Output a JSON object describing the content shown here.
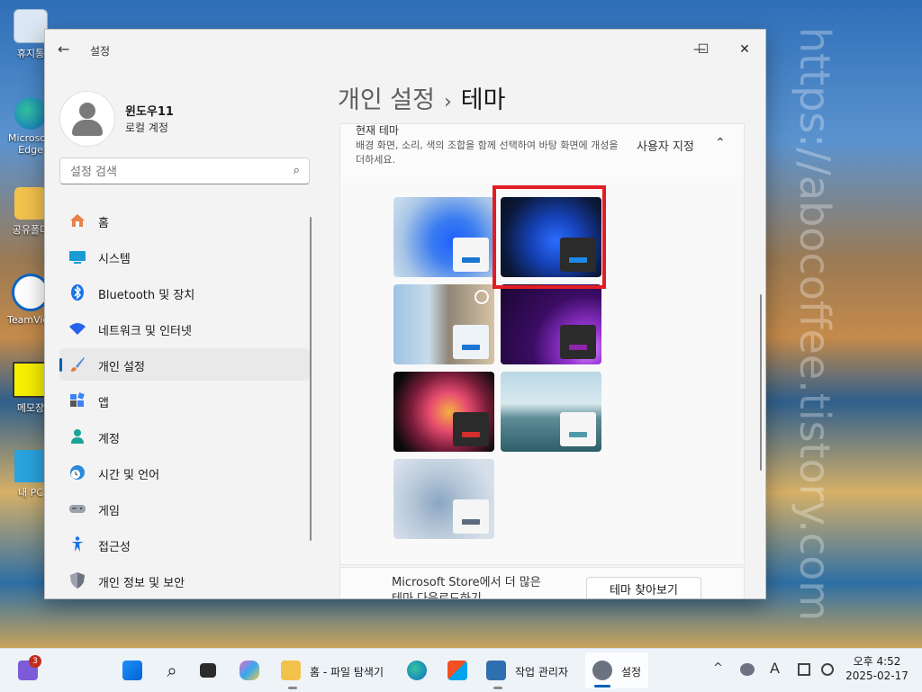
{
  "desktop": {
    "icons": [
      {
        "label": "휴지통",
        "icon": "recycle-bin-icon"
      },
      {
        "label": "Microsoft Edge",
        "icon": "edge-icon"
      },
      {
        "label": "공유폴더",
        "icon": "folder-icon"
      },
      {
        "label": "TeamViewer",
        "icon": "teamviewer-icon"
      },
      {
        "label": "메모장",
        "icon": "notepad-icon"
      },
      {
        "label": "내 PC",
        "icon": "pc-icon"
      }
    ],
    "watermark": "https://abocoffee.tistory.com"
  },
  "window": {
    "title": "설정",
    "controls": {
      "minimize": "—",
      "maximize": "☐",
      "close": "✕"
    }
  },
  "profile": {
    "name": "윈도우11",
    "account": "로컬 계정"
  },
  "search": {
    "placeholder": "설정 검색"
  },
  "nav": {
    "items": [
      {
        "label": "홈",
        "icon": "home-icon",
        "color": "#e8804a"
      },
      {
        "label": "시스템",
        "icon": "system-icon",
        "color": "#1a9bd7"
      },
      {
        "label": "Bluetooth 및 장치",
        "icon": "bluetooth-icon",
        "color": "#1a73e8"
      },
      {
        "label": "네트워크 및 인터넷",
        "icon": "wifi-icon",
        "color": "#2563eb"
      },
      {
        "label": "개인 설정",
        "icon": "brush-icon",
        "color": "#e87b3a",
        "active": true
      },
      {
        "label": "앱",
        "icon": "apps-icon",
        "color": "#3b82f6"
      },
      {
        "label": "계정",
        "icon": "account-icon",
        "color": "#1aa39a"
      },
      {
        "label": "시간 및 언어",
        "icon": "globe-clock-icon",
        "color": "#2b8ad8"
      },
      {
        "label": "게임",
        "icon": "gamepad-icon",
        "color": "#7a8594"
      },
      {
        "label": "접근성",
        "icon": "accessibility-icon",
        "color": "#1a73e8"
      },
      {
        "label": "개인 정보 및 보안",
        "icon": "shield-icon",
        "color": "#6b7280"
      }
    ]
  },
  "header": {
    "breadcrumb_parent": "개인 설정",
    "separator": "›",
    "current": "테마"
  },
  "current_theme": {
    "title": "현재 테마",
    "description": "배경 화면, 소리, 색의 조합을 함께 선택하여 바탕 화면에 개성을 더하세요.",
    "value": "사용자 지정",
    "chevron": "⌃"
  },
  "themes": [
    {
      "name": "windows-light",
      "selected": false
    },
    {
      "name": "windows-dark",
      "selected": true
    },
    {
      "name": "windows-spotlight",
      "selected": false
    },
    {
      "name": "glow",
      "selected": false
    },
    {
      "name": "captured-motion",
      "selected": false
    },
    {
      "name": "sunrise",
      "selected": false
    },
    {
      "name": "flow",
      "selected": false
    }
  ],
  "store": {
    "text_line1": "Microsoft Store에서 더 많은",
    "text_line2": "테마 다운로드하기",
    "button": "테마 찾아보기"
  },
  "taskbar": {
    "pinned": [
      {
        "icon": "start-icon"
      },
      {
        "icon": "search-icon"
      },
      {
        "icon": "task-view-icon"
      },
      {
        "icon": "copilot-icon"
      },
      {
        "icon": "file-explorer-icon",
        "label": "홈 - 파일 탐색기"
      },
      {
        "icon": "edge-icon"
      },
      {
        "icon": "store-icon"
      },
      {
        "icon": "task-manager-icon",
        "label": "작업 관리자"
      },
      {
        "icon": "settings-icon",
        "label": "설정"
      }
    ],
    "badge_count": "3",
    "tray": {
      "chevron": "^",
      "ime": "A"
    },
    "clock": {
      "time": "오후 4:52",
      "date": "2025-02-17"
    }
  }
}
